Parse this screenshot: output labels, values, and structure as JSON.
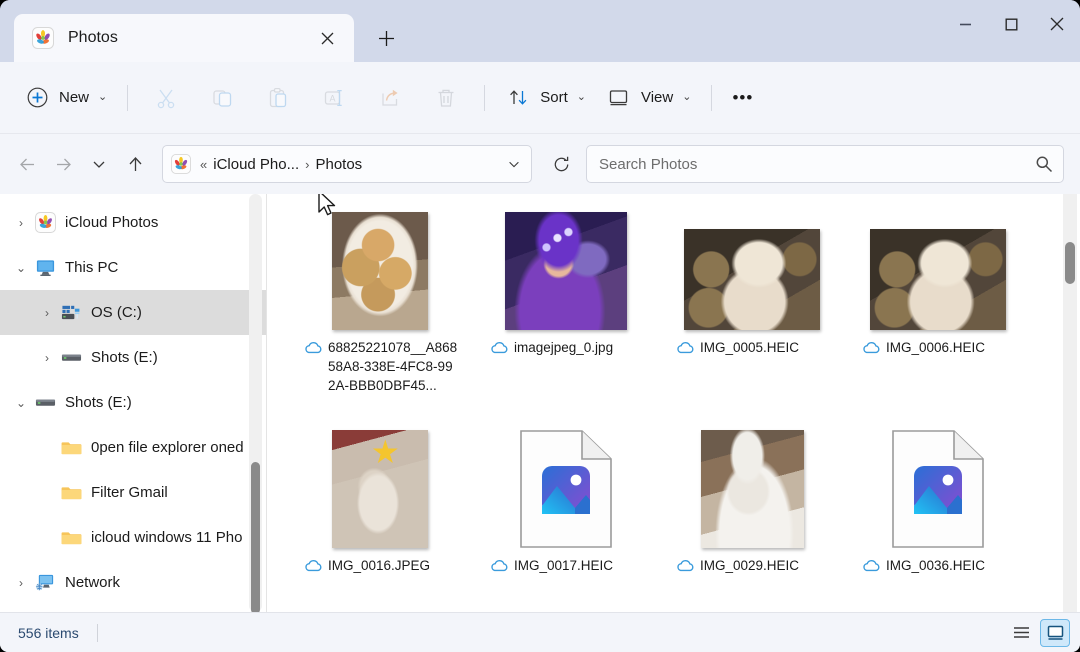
{
  "window": {
    "titlebar": {
      "tab": {
        "label": "Photos",
        "icon": "photos-app-icon",
        "close_icon": "close-icon"
      },
      "new_tab_icon": "plus-icon",
      "minimize_label": "—",
      "maximize_label": "□",
      "close_label": "✕"
    },
    "toolbar": {
      "new_label": "New",
      "new_icon": "plus-circle-icon",
      "cut_icon": "scissors-icon",
      "copy_icon": "copy-icon",
      "paste_icon": "paste-icon",
      "rename_icon": "rename-icon",
      "share_icon": "share-icon",
      "delete_icon": "trash-icon",
      "sort_label": "Sort",
      "sort_icon": "sort-arrows-icon",
      "view_label": "View",
      "view_icon": "monitor-icon",
      "more_label": "•••",
      "chevron": "⌄"
    },
    "address": {
      "back_icon": "arrow-left-icon",
      "forward_icon": "arrow-right-icon",
      "recent_icon": "chevron-down-icon",
      "up_icon": "arrow-up-icon",
      "path_icon": "photos-app-icon",
      "overflow": "«",
      "crumbs": [
        "iCloud Pho...",
        "Photos"
      ],
      "crumb_separator": "›",
      "dropdown_icon": "chevron-down-icon",
      "refresh_icon": "refresh-icon"
    },
    "search": {
      "placeholder": "Search Photos",
      "value": "",
      "icon": "search-icon"
    },
    "sidebar": {
      "items": [
        {
          "label": "iCloud Photos",
          "icon": "photos-app-icon",
          "twisty": "›",
          "indent": 0,
          "selected": false
        },
        {
          "label": "This PC",
          "icon": "this-pc-icon",
          "twisty": "⌄",
          "indent": 0,
          "selected": false
        },
        {
          "label": "OS (C:)",
          "icon": "os-drive-icon",
          "twisty": "›",
          "indent": 1,
          "selected": true
        },
        {
          "label": "Shots (E:)",
          "icon": "drive-icon",
          "twisty": "›",
          "indent": 1,
          "selected": false
        },
        {
          "label": "Shots (E:)",
          "icon": "drive-icon",
          "twisty": "⌄",
          "indent": 0,
          "selected": false
        },
        {
          "label": "0pen file explorer oned",
          "icon": "folder-icon",
          "twisty": "",
          "indent": 1,
          "selected": false
        },
        {
          "label": "Filter Gmail",
          "icon": "folder-icon",
          "twisty": "",
          "indent": 1,
          "selected": false
        },
        {
          "label": "icloud windows 11 Pho",
          "icon": "folder-icon",
          "twisty": "",
          "indent": 1,
          "selected": false
        },
        {
          "label": "Network",
          "icon": "network-icon",
          "twisty": "›",
          "indent": 0,
          "selected": false
        }
      ]
    },
    "files": [
      {
        "name": "68825221078__A86858A8-338E-4FC8-992A-BBB0DBF45...",
        "thumb": "photo-cookies",
        "cloud_icon": "cloud-icon"
      },
      {
        "name": "imagejpeg_0.jpg",
        "thumb": "photo-couple-lights",
        "cloud_icon": "cloud-icon"
      },
      {
        "name": "IMG_0005.HEIC",
        "thumb": "photo-white-dog",
        "cloud_icon": "cloud-icon"
      },
      {
        "name": "IMG_0006.HEIC",
        "thumb": "photo-white-dog",
        "cloud_icon": "cloud-icon"
      },
      {
        "name": "IMG_0016.JPEG",
        "thumb": "photo-small-dog-star",
        "cloud_icon": "cloud-icon"
      },
      {
        "name": "IMG_0017.HEIC",
        "thumb": "placeholder-photos-doc",
        "cloud_icon": "cloud-icon"
      },
      {
        "name": "IMG_0029.HEIC",
        "thumb": "photo-cat",
        "cloud_icon": "cloud-icon"
      },
      {
        "name": "IMG_0036.HEIC",
        "thumb": "placeholder-photos-doc",
        "cloud_icon": "cloud-icon"
      }
    ],
    "statusbar": {
      "item_count": "556 items",
      "details_view_icon": "list-view-icon",
      "large_icons_view_icon": "large-icons-view-icon"
    },
    "colors": {
      "titlebar_bg": "#d2d9ea",
      "toolbar_bg": "#f3f5fa",
      "accent_blue": "#0a78d4",
      "selected_row": "#dcdcdc",
      "cloud_blue": "#3a9bdc",
      "status_text": "#2b4a70"
    }
  }
}
